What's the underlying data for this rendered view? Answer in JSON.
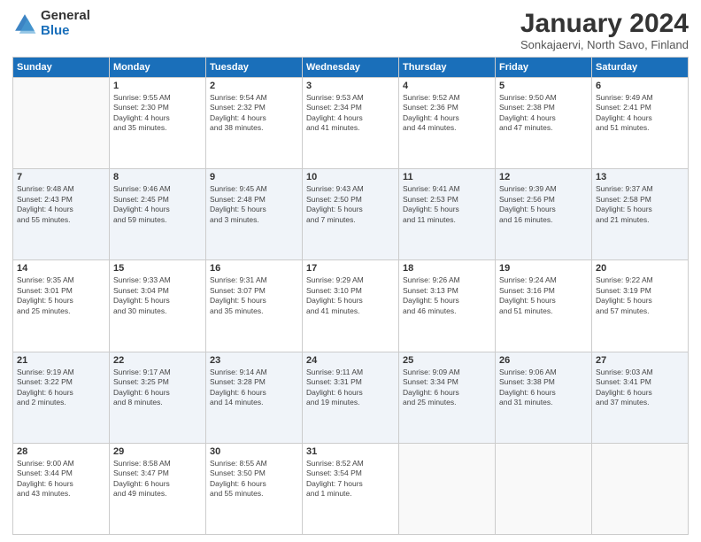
{
  "header": {
    "logo_general": "General",
    "logo_blue": "Blue",
    "title": "January 2024",
    "subtitle": "Sonkajaervi, North Savo, Finland"
  },
  "days_of_week": [
    "Sunday",
    "Monday",
    "Tuesday",
    "Wednesday",
    "Thursday",
    "Friday",
    "Saturday"
  ],
  "weeks": [
    [
      {
        "day": "",
        "info": ""
      },
      {
        "day": "1",
        "info": "Sunrise: 9:55 AM\nSunset: 2:30 PM\nDaylight: 4 hours\nand 35 minutes."
      },
      {
        "day": "2",
        "info": "Sunrise: 9:54 AM\nSunset: 2:32 PM\nDaylight: 4 hours\nand 38 minutes."
      },
      {
        "day": "3",
        "info": "Sunrise: 9:53 AM\nSunset: 2:34 PM\nDaylight: 4 hours\nand 41 minutes."
      },
      {
        "day": "4",
        "info": "Sunrise: 9:52 AM\nSunset: 2:36 PM\nDaylight: 4 hours\nand 44 minutes."
      },
      {
        "day": "5",
        "info": "Sunrise: 9:50 AM\nSunset: 2:38 PM\nDaylight: 4 hours\nand 47 minutes."
      },
      {
        "day": "6",
        "info": "Sunrise: 9:49 AM\nSunset: 2:41 PM\nDaylight: 4 hours\nand 51 minutes."
      }
    ],
    [
      {
        "day": "7",
        "info": "Sunrise: 9:48 AM\nSunset: 2:43 PM\nDaylight: 4 hours\nand 55 minutes."
      },
      {
        "day": "8",
        "info": "Sunrise: 9:46 AM\nSunset: 2:45 PM\nDaylight: 4 hours\nand 59 minutes."
      },
      {
        "day": "9",
        "info": "Sunrise: 9:45 AM\nSunset: 2:48 PM\nDaylight: 5 hours\nand 3 minutes."
      },
      {
        "day": "10",
        "info": "Sunrise: 9:43 AM\nSunset: 2:50 PM\nDaylight: 5 hours\nand 7 minutes."
      },
      {
        "day": "11",
        "info": "Sunrise: 9:41 AM\nSunset: 2:53 PM\nDaylight: 5 hours\nand 11 minutes."
      },
      {
        "day": "12",
        "info": "Sunrise: 9:39 AM\nSunset: 2:56 PM\nDaylight: 5 hours\nand 16 minutes."
      },
      {
        "day": "13",
        "info": "Sunrise: 9:37 AM\nSunset: 2:58 PM\nDaylight: 5 hours\nand 21 minutes."
      }
    ],
    [
      {
        "day": "14",
        "info": "Sunrise: 9:35 AM\nSunset: 3:01 PM\nDaylight: 5 hours\nand 25 minutes."
      },
      {
        "day": "15",
        "info": "Sunrise: 9:33 AM\nSunset: 3:04 PM\nDaylight: 5 hours\nand 30 minutes."
      },
      {
        "day": "16",
        "info": "Sunrise: 9:31 AM\nSunset: 3:07 PM\nDaylight: 5 hours\nand 35 minutes."
      },
      {
        "day": "17",
        "info": "Sunrise: 9:29 AM\nSunset: 3:10 PM\nDaylight: 5 hours\nand 41 minutes."
      },
      {
        "day": "18",
        "info": "Sunrise: 9:26 AM\nSunset: 3:13 PM\nDaylight: 5 hours\nand 46 minutes."
      },
      {
        "day": "19",
        "info": "Sunrise: 9:24 AM\nSunset: 3:16 PM\nDaylight: 5 hours\nand 51 minutes."
      },
      {
        "day": "20",
        "info": "Sunrise: 9:22 AM\nSunset: 3:19 PM\nDaylight: 5 hours\nand 57 minutes."
      }
    ],
    [
      {
        "day": "21",
        "info": "Sunrise: 9:19 AM\nSunset: 3:22 PM\nDaylight: 6 hours\nand 2 minutes."
      },
      {
        "day": "22",
        "info": "Sunrise: 9:17 AM\nSunset: 3:25 PM\nDaylight: 6 hours\nand 8 minutes."
      },
      {
        "day": "23",
        "info": "Sunrise: 9:14 AM\nSunset: 3:28 PM\nDaylight: 6 hours\nand 14 minutes."
      },
      {
        "day": "24",
        "info": "Sunrise: 9:11 AM\nSunset: 3:31 PM\nDaylight: 6 hours\nand 19 minutes."
      },
      {
        "day": "25",
        "info": "Sunrise: 9:09 AM\nSunset: 3:34 PM\nDaylight: 6 hours\nand 25 minutes."
      },
      {
        "day": "26",
        "info": "Sunrise: 9:06 AM\nSunset: 3:38 PM\nDaylight: 6 hours\nand 31 minutes."
      },
      {
        "day": "27",
        "info": "Sunrise: 9:03 AM\nSunset: 3:41 PM\nDaylight: 6 hours\nand 37 minutes."
      }
    ],
    [
      {
        "day": "28",
        "info": "Sunrise: 9:00 AM\nSunset: 3:44 PM\nDaylight: 6 hours\nand 43 minutes."
      },
      {
        "day": "29",
        "info": "Sunrise: 8:58 AM\nSunset: 3:47 PM\nDaylight: 6 hours\nand 49 minutes."
      },
      {
        "day": "30",
        "info": "Sunrise: 8:55 AM\nSunset: 3:50 PM\nDaylight: 6 hours\nand 55 minutes."
      },
      {
        "day": "31",
        "info": "Sunrise: 8:52 AM\nSunset: 3:54 PM\nDaylight: 7 hours\nand 1 minute."
      },
      {
        "day": "",
        "info": ""
      },
      {
        "day": "",
        "info": ""
      },
      {
        "day": "",
        "info": ""
      }
    ]
  ]
}
